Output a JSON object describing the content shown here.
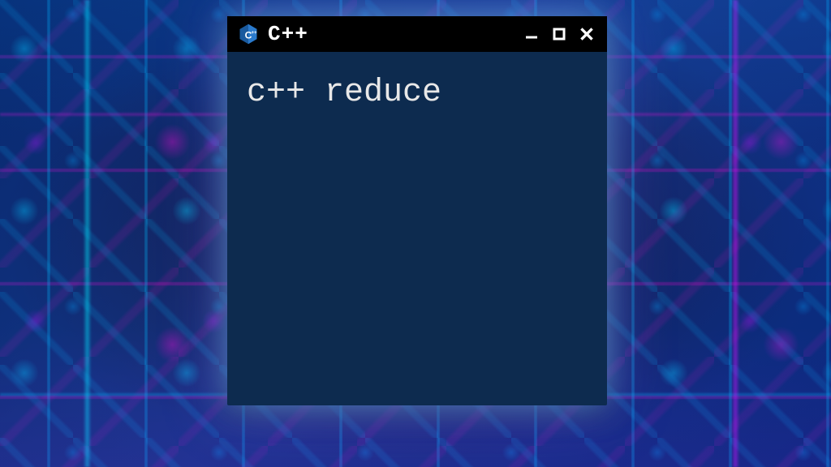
{
  "window": {
    "title": "C++",
    "icon_name": "cpp-logo-icon"
  },
  "content": {
    "code_text": "c++ reduce"
  },
  "colors": {
    "titlebar_bg": "#000000",
    "content_bg": "#0d2b4f",
    "text": "#e8e8e8",
    "glow_cyan": "#00c8ff",
    "glow_magenta": "#ff00c8"
  }
}
